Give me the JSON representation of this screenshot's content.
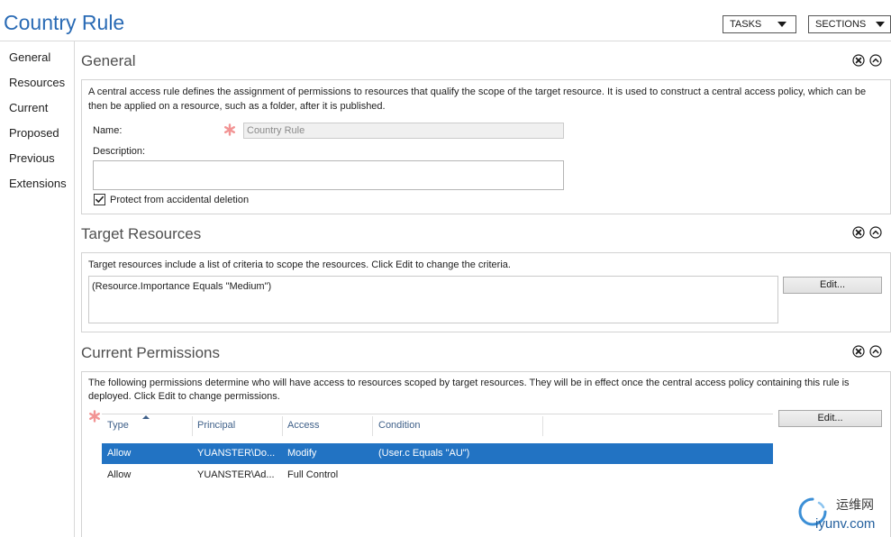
{
  "window": {
    "title": "Country Rule",
    "tasks_label": "TASKS",
    "sections_label": "SECTIONS"
  },
  "nav": {
    "items": [
      "General",
      "Resources",
      "Current",
      "Proposed",
      "Previous",
      "Extensions"
    ]
  },
  "icons": {
    "section_close": "close-circle-icon",
    "section_collapse": "chevron-up-circle-icon",
    "dropdown": "caret-down-icon",
    "required": "required-asterisk-icon",
    "sort": "sort-ascending-icon",
    "checkbox": "checkmark-icon",
    "watermark_logo": "swirl-logo-icon"
  },
  "colors": {
    "title": "#2a6bb5",
    "selection": "#2273c3",
    "required": "#f29494",
    "column_header": "#3f6089",
    "border": "#d2d2d2"
  },
  "general": {
    "heading": "General",
    "description": "A central access rule defines the assignment of permissions to resources that qualify the scope of the target resource. It is used to construct a central access policy, which can be then be applied on a resource, such as a folder, after it is published.",
    "name_label": "Name:",
    "name_value": "Country Rule",
    "name_required": true,
    "description_label": "Description:",
    "description_value": "",
    "protect_label": "Protect from accidental deletion",
    "protect_checked": true
  },
  "target_resources": {
    "heading": "Target Resources",
    "description": "Target resources include a list of criteria to scope the resources. Click Edit to change the criteria.",
    "criteria": [
      "(Resource.Importance Equals \"Medium\")"
    ],
    "edit_label": "Edit..."
  },
  "current_permissions": {
    "heading": "Current Permissions",
    "description": "The following permissions determine who will have access to resources scoped by target resources. They will be in effect once the central access policy containing this rule is deployed. Click Edit to change permissions.",
    "required": true,
    "edit_label": "Edit...",
    "columns": [
      "Type",
      "Principal",
      "Access",
      "Condition"
    ],
    "rows": [
      {
        "type": "Allow",
        "principal": "YUANSTER\\Do...",
        "access": "Modify",
        "condition": "(User.c Equals \"AU\")",
        "selected": true
      },
      {
        "type": "Allow",
        "principal": "YUANSTER\\Ad...",
        "access": "Full Control",
        "condition": "",
        "selected": false
      }
    ]
  },
  "watermark": {
    "brand_cn": "运维网",
    "brand_url": "iyunv.com"
  }
}
